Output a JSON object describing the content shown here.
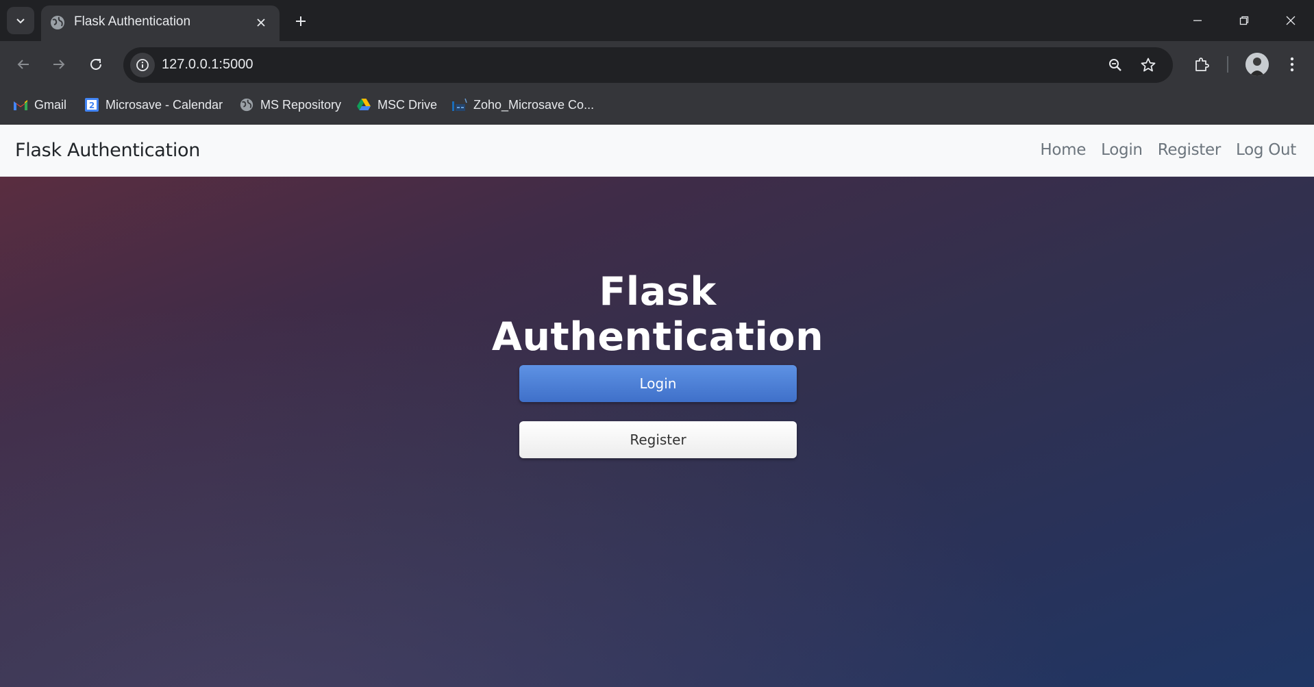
{
  "browser": {
    "tab": {
      "title": "Flask Authentication"
    },
    "address": {
      "url": "127.0.0.1:5000"
    },
    "bookmarks": [
      {
        "label": "Gmail",
        "icon": "gmail-icon"
      },
      {
        "label": "Microsave - Calendar",
        "icon": "calendar-icon"
      },
      {
        "label": "MS Repository",
        "icon": "globe-icon"
      },
      {
        "label": "MSC Drive",
        "icon": "drive-icon"
      },
      {
        "label": "Zoho_Microsave Co...",
        "icon": "zoho-icon"
      }
    ]
  },
  "navbar": {
    "brand": "Flask Authentication",
    "links": [
      {
        "label": "Home"
      },
      {
        "label": "Login"
      },
      {
        "label": "Register"
      },
      {
        "label": "Log Out"
      }
    ]
  },
  "hero": {
    "title_line1": "Flask",
    "title_line2": "Authentication",
    "login_label": "Login",
    "register_label": "Register"
  },
  "colors": {
    "browser_dark": "#202124",
    "browser_toolbar": "#35363a",
    "navbar_bg": "#f8f9fa",
    "login_button": "#4a7fd8",
    "register_button": "#ffffff",
    "hero_gradient_start": "#5a2d40",
    "hero_gradient_end": "#1f3664"
  }
}
